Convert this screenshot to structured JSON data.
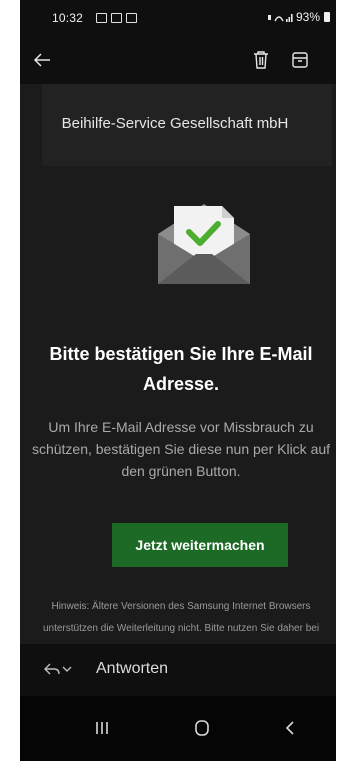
{
  "status_bar": {
    "time": "10:32",
    "battery": "93%",
    "notification_icons": [
      "message-icon",
      "calendar-icon",
      "gallery-icon"
    ]
  },
  "toolbar": {
    "back_icon": "arrow-left-icon",
    "delete_icon": "trash-icon",
    "archive_icon": "archive-icon"
  },
  "email": {
    "sender": "Beihilfe-Service Gesellschaft mbH",
    "headline": "Bitte bestätigen Sie Ihre E-Mail Adresse.",
    "intro": "Um Ihre E-Mail Adresse vor Missbrauch zu schützen, bestätigen Sie diese nun per Klick auf den grünen Button.",
    "cta_label": "Jetzt weitermachen",
    "hint": "Hinweis: Ältere Versionen des Samsung Internet Browsers unterstützen die Weiterleitung nicht. Bitte nutzen Sie daher bei Problemen einen anderen",
    "envelope_icon": "envelope-check-icon",
    "cta_color": "#1d6a26"
  },
  "reply_bar": {
    "label": "Antworten",
    "reply_icon": "reply-icon",
    "chevron_icon": "chevron-down-icon"
  },
  "nav_bar": {
    "recent_icon": "recent-apps-icon",
    "home_icon": "home-icon",
    "back_icon": "back-icon"
  }
}
